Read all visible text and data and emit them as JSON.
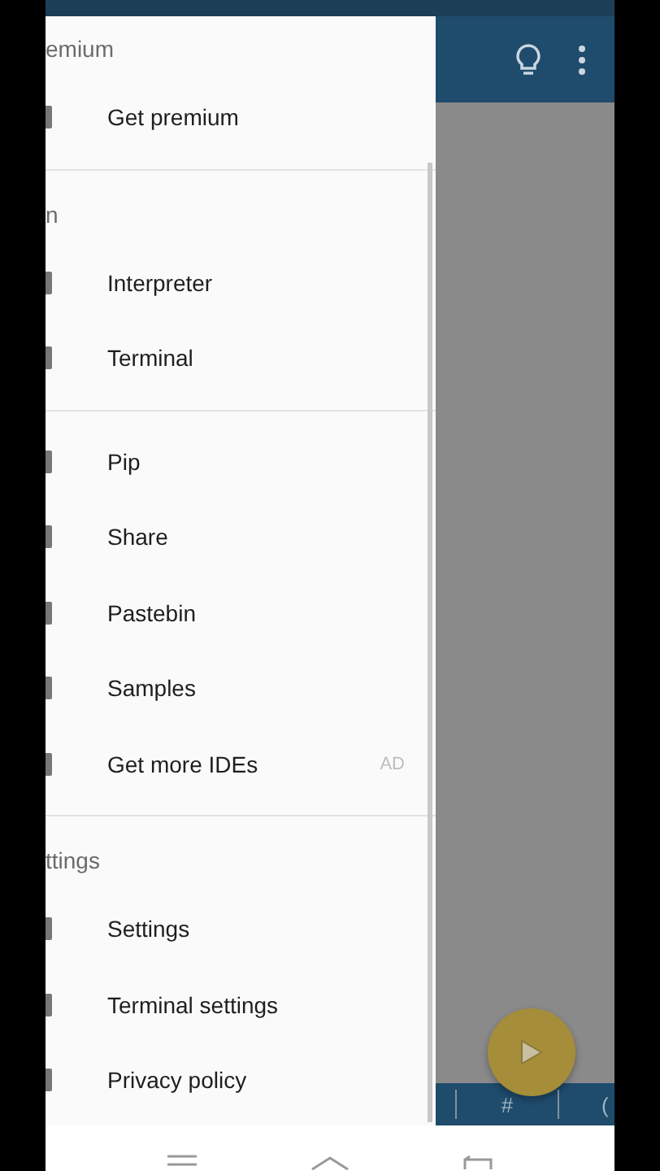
{
  "drawer": {
    "sections": [
      {
        "header": "emium",
        "items": [
          {
            "label": "Get premium"
          }
        ]
      },
      {
        "header": "n",
        "items": [
          {
            "label": "Interpreter"
          },
          {
            "label": "Terminal"
          }
        ]
      },
      {
        "items": [
          {
            "label": "Pip"
          },
          {
            "label": "Share"
          },
          {
            "label": "Pastebin"
          },
          {
            "label": "Samples"
          },
          {
            "label": "Get more IDEs",
            "badge": "AD"
          }
        ]
      },
      {
        "header": "ttings",
        "items": [
          {
            "label": "Settings"
          },
          {
            "label": "Terminal settings"
          },
          {
            "label": "Privacy policy"
          }
        ]
      }
    ]
  },
  "keyboard_bar": {
    "keys": [
      "#",
      "("
    ]
  }
}
